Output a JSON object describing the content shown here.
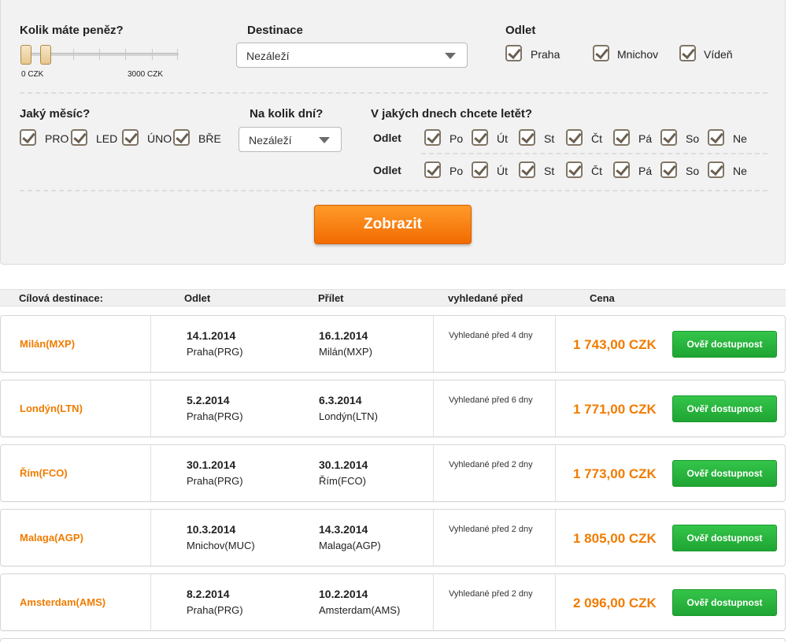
{
  "filters": {
    "money": {
      "label": "Kolik máte peněz?",
      "min_label": "0 CZK",
      "max_label": "3000 CZK"
    },
    "destination": {
      "label": "Destinace",
      "selected": "Nezáleží"
    },
    "departure": {
      "label": "Odlet",
      "options": [
        "Praha",
        "Mnichov",
        "Vídeň"
      ]
    },
    "month": {
      "label": "Jaký měsíc?",
      "options": [
        "PRO",
        "LED",
        "ÚNO",
        "BŘE"
      ]
    },
    "days": {
      "label": "Na kolik dní?",
      "selected": "Nezáleží"
    },
    "weekdays": {
      "label": "V jakých dnech chcete letět?",
      "row1_label": "Odlet",
      "row2_label": "Odlet",
      "days": [
        "Po",
        "Út",
        "St",
        "Čt",
        "Pá",
        "So",
        "Ne"
      ]
    },
    "submit_label": "Zobrazit"
  },
  "table": {
    "headers": [
      "Cílová destinace:",
      "Odlet",
      "Přílet",
      "vyhledané před",
      "Cena"
    ],
    "check_label": "Ověř dostupnost",
    "rows": [
      {
        "destination": "Milán(MXP)",
        "dep_date": "14.1.2014",
        "dep_place": "Praha(PRG)",
        "arr_date": "16.1.2014",
        "arr_place": "Milán(MXP)",
        "searched": "Vyhledané před 4 dny",
        "price": "1 743,00 CZK"
      },
      {
        "destination": "Londýn(LTN)",
        "dep_date": "5.2.2014",
        "dep_place": "Praha(PRG)",
        "arr_date": "6.3.2014",
        "arr_place": "Londýn(LTN)",
        "searched": "Vyhledané před 6 dny",
        "price": "1 771,00 CZK"
      },
      {
        "destination": "Řím(FCO)",
        "dep_date": "30.1.2014",
        "dep_place": "Praha(PRG)",
        "arr_date": "30.1.2014",
        "arr_place": "Řím(FCO)",
        "searched": "Vyhledané před 2 dny",
        "price": "1 773,00 CZK"
      },
      {
        "destination": "Malaga(AGP)",
        "dep_date": "10.3.2014",
        "dep_place": "Mnichov(MUC)",
        "arr_date": "14.3.2014",
        "arr_place": "Malaga(AGP)",
        "searched": "Vyhledané před 2 dny",
        "price": "1 805,00 CZK"
      },
      {
        "destination": "Amsterdam(AMS)",
        "dep_date": "8.2.2014",
        "dep_place": "Praha(PRG)",
        "arr_date": "10.2.2014",
        "arr_place": "Amsterdam(AMS)",
        "searched": "Vyhledané před 2 dny",
        "price": "2 096,00 CZK"
      }
    ]
  }
}
